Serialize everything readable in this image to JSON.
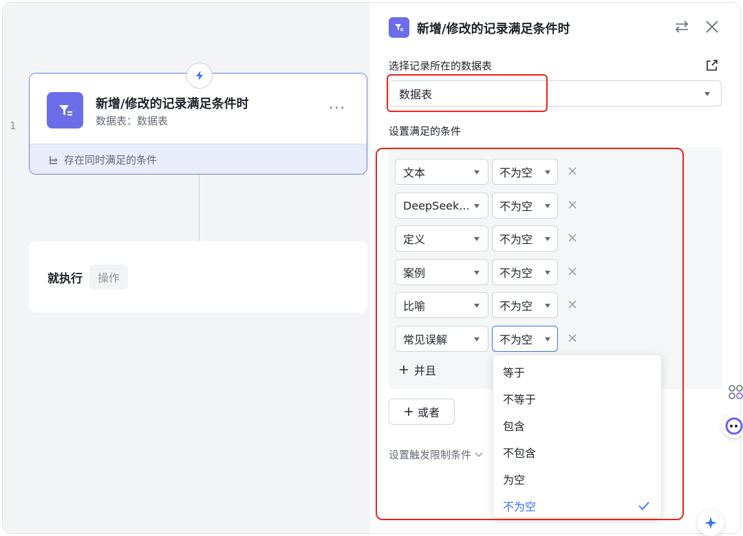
{
  "canvas": {
    "row_number": "1",
    "trigger": {
      "title": "新增/修改的记录满足条件时",
      "subtitle": "数据表：数据表",
      "more": "···",
      "condition_note": "存在同时满足的条件"
    },
    "action": {
      "label": "就执行",
      "chip": "操作"
    }
  },
  "panel": {
    "title": "新增/修改的记录满足条件时",
    "table_label": "选择记录所在的数据表",
    "table_value": "数据表",
    "conditions_label": "设置满足的条件",
    "conditions": [
      {
        "field": "文本",
        "op": "不为空"
      },
      {
        "field": "DeepSeek...",
        "op": "不为空"
      },
      {
        "field": "定义",
        "op": "不为空"
      },
      {
        "field": "案例",
        "op": "不为空"
      },
      {
        "field": "比喻",
        "op": "不为空"
      },
      {
        "field": "常见误解",
        "op": "不为空"
      }
    ],
    "and_label": "并且",
    "or_label": "或者",
    "limit_label": "设置触发限制条件",
    "operator_options": [
      "等于",
      "不等于",
      "包含",
      "不包含",
      "为空",
      "不为空"
    ],
    "selected_operator": "不为空"
  },
  "colors": {
    "accent": "#3370ff",
    "brand_icon": "#6b6ee8",
    "highlight_border": "#e5231b",
    "trigger_border": "#6a7cf0"
  },
  "icons": [
    "lightning-icon",
    "filter-icon",
    "branch-icon",
    "swap-icon",
    "close-icon",
    "external-link-icon",
    "chevron-down-icon",
    "plus-icon",
    "check-icon",
    "sparkle-icon"
  ]
}
